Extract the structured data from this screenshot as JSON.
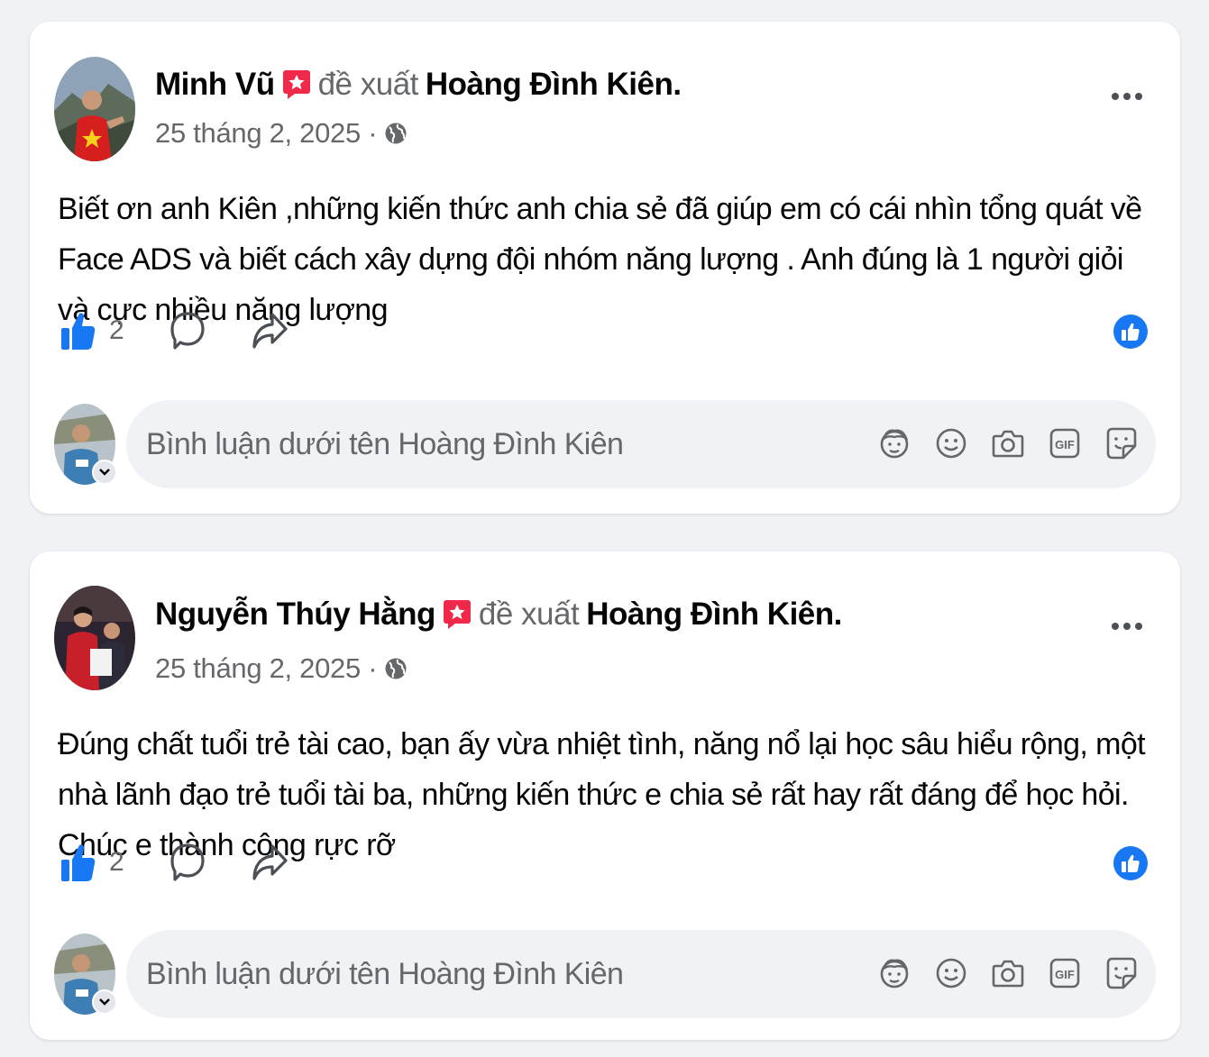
{
  "posts": [
    {
      "author": "Minh Vũ",
      "verb": "đề xuất",
      "target": "Hoàng Đình Kiên.",
      "date": "25 tháng 2, 2025 ·",
      "text": "Biết ơn anh Kiên ,những kiến thức anh chia sẻ đã giúp em có cái nhìn tổng quát về Face ADS và biết cách xây dựng đội nhóm năng lượng . Anh đúng là 1 người giỏi và cực nhiều năng lượng",
      "like_count": "2",
      "comment_placeholder": "Bình luận dưới tên Hoàng Đình Kiên"
    },
    {
      "author": "Nguyễn Thúy Hằng",
      "verb": "đề xuất",
      "target": "Hoàng Đình Kiên.",
      "date": "25 tháng 2, 2025 ·",
      "text": "Đúng chất tuổi trẻ tài cao, bạn ấy vừa nhiệt tình, năng nổ lại học sâu hiểu rộng, một nhà lãnh đạo trẻ tuổi tài ba, những kiến thức e chia sẻ rất hay rất đáng để học hỏi. Chúc e thành công rực rỡ",
      "like_count": "2",
      "comment_placeholder": "Bình luận dưới tên Hoàng Đình Kiên"
    }
  ],
  "colors": {
    "brand_blue": "#1877f2",
    "recommend_badge": "#f02849",
    "secondary_text": "#65676b",
    "page_bg": "#f0f2f5"
  },
  "icons": {
    "badge": "recommend-star-badge-icon",
    "privacy": "globe-icon",
    "more": "more-horizontal-icon",
    "like": "thumbs-up-icon",
    "comment": "comment-bubble-icon",
    "share": "share-arrow-icon",
    "reaction": "like-reaction-icon",
    "tools": [
      "avatar-sticker-icon",
      "emoji-icon",
      "camera-icon",
      "gif-icon",
      "sticker-icon"
    ]
  }
}
